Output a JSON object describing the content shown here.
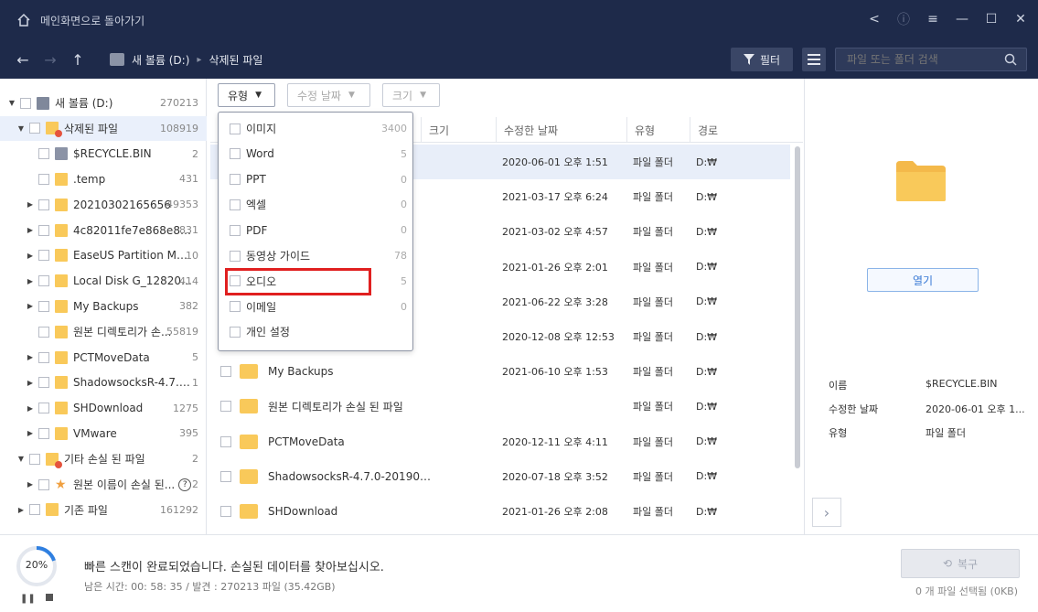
{
  "app": {
    "title": "메인화면으로 돌아가기"
  },
  "nav": {
    "breadcrumb": [
      "새 볼륨 (D:)",
      "삭제된 파일"
    ],
    "filter_label": "필터",
    "search_placeholder": "파일 또는 폴더 검색"
  },
  "tree": [
    {
      "label": "새 볼륨 (D:)",
      "count": "270213",
      "indent": 0,
      "expanded": true,
      "type": "drive"
    },
    {
      "label": "삭제된 파일",
      "count": "108919",
      "indent": 1,
      "expanded": true,
      "type": "deleted",
      "selected": true
    },
    {
      "label": "$RECYCLE.BIN",
      "count": "2",
      "indent": 2,
      "expandable": false,
      "type": "recycle"
    },
    {
      "label": ".temp",
      "count": "431",
      "indent": 2,
      "expandable": false,
      "type": "folder"
    },
    {
      "label": "20210302165656",
      "count": "49353",
      "indent": 2,
      "expandable": true,
      "type": "folder"
    },
    {
      "label": "4c82011fe7e868e8df9...",
      "count": "831",
      "indent": 2,
      "expandable": true,
      "type": "folder"
    },
    {
      "label": "EaseUS Partition Maste...",
      "count": "10",
      "indent": 2,
      "expandable": true,
      "type": "folder"
    },
    {
      "label": "Local Disk G_1282020...",
      "count": "414",
      "indent": 2,
      "expandable": true,
      "type": "folder"
    },
    {
      "label": "My Backups",
      "count": "382",
      "indent": 2,
      "expandable": true,
      "type": "folder"
    },
    {
      "label": "원본 디렉토리가 손...",
      "count": "55819",
      "indent": 2,
      "expandable": false,
      "type": "folder"
    },
    {
      "label": "PCTMoveData",
      "count": "5",
      "indent": 2,
      "expandable": true,
      "type": "folder"
    },
    {
      "label": "ShadowsocksR-4.7.0-201...",
      "count": "1",
      "indent": 2,
      "expandable": true,
      "type": "folder"
    },
    {
      "label": "SHDownload",
      "count": "1275",
      "indent": 2,
      "expandable": true,
      "type": "folder"
    },
    {
      "label": "VMware",
      "count": "395",
      "indent": 2,
      "expandable": true,
      "type": "folder"
    },
    {
      "label": "기타 손실 된 파일",
      "count": "2",
      "indent": 1,
      "expanded": true,
      "type": "lost"
    },
    {
      "label": "원본 이름이 손실 된...",
      "count": "2",
      "indent": 2,
      "expandable": true,
      "type": "star",
      "help": "?"
    },
    {
      "label": "기존 파일",
      "count": "161292",
      "indent": 1,
      "expandable": true,
      "type": "folder"
    }
  ],
  "filter_tabs": [
    {
      "label": "유형",
      "active": true
    },
    {
      "label": "수정 날짜",
      "active": false
    },
    {
      "label": "크기",
      "active": false
    }
  ],
  "dropdown": [
    {
      "label": "이미지",
      "count": "3400"
    },
    {
      "label": "Word",
      "count": "5"
    },
    {
      "label": "PPT",
      "count": "0"
    },
    {
      "label": "엑셀",
      "count": "0"
    },
    {
      "label": "PDF",
      "count": "0"
    },
    {
      "label": "동영상 가이드",
      "count": "78"
    },
    {
      "label": "오디오",
      "count": "5"
    },
    {
      "label": "이메일",
      "count": "0"
    },
    {
      "label": "개인 설정",
      "count": ""
    }
  ],
  "table": {
    "headers": [
      "크기",
      "수정한 날짜",
      "유형",
      "경로"
    ],
    "rows": [
      {
        "name": "",
        "date": "2020-06-01 오후 1:51",
        "type": "파일 폴더",
        "path": "D:₩",
        "selected": true
      },
      {
        "name": "",
        "date": "2021-03-17 오후 6:24",
        "type": "파일 폴더",
        "path": "D:₩"
      },
      {
        "name": "",
        "date": "2021-03-02 오후 4:57",
        "type": "파일 폴더",
        "path": "D:₩"
      },
      {
        "name": "",
        "date": "2021-01-26 오후 2:01",
        "type": "파일 폴더",
        "path": "D:₩"
      },
      {
        "name": "",
        "date": "2021-06-22 오후 3:28",
        "type": "파일 폴더",
        "path": "D:₩"
      },
      {
        "name": "",
        "date": "2020-12-08 오후 12:53",
        "type": "파일 폴더",
        "path": "D:₩"
      },
      {
        "name": "My Backups",
        "date": "2021-06-10 오후 1:53",
        "type": "파일 폴더",
        "path": "D:₩"
      },
      {
        "name": "원본 디렉토리가 손실 된 파일",
        "date": "",
        "type": "파일 폴더",
        "path": "D:₩"
      },
      {
        "name": "PCTMoveData",
        "date": "2020-12-11 오후 4:11",
        "type": "파일 폴더",
        "path": "D:₩"
      },
      {
        "name": "ShadowsocksR-4.7.0-2019092...",
        "date": "2020-07-18 오후 3:52",
        "type": "파일 폴더",
        "path": "D:₩"
      },
      {
        "name": "SHDownload",
        "date": "2021-01-26 오후 2:08",
        "type": "파일 폴더",
        "path": "D:₩"
      }
    ]
  },
  "preview": {
    "open_label": "열기",
    "props": [
      {
        "key": "이름",
        "value": "$RECYCLE.BIN"
      },
      {
        "key": "수정한 날짜",
        "value": "2020-06-01 오후 1..."
      },
      {
        "key": "유형",
        "value": "파일 폴더"
      }
    ]
  },
  "footer": {
    "progress": "20%",
    "progress_value": 0.2,
    "status": "빠른 스캔이 완료되었습니다. 손실된  데이터를 찾아보십시오.",
    "sub_status": "남은 시간: 00: 58: 35 / 발견 : 270213 파일 (35.42GB)",
    "recover_label": "복구",
    "selection": "0 개 파일 선택됨 (0KB)"
  },
  "colors": {
    "titlebar": "#1e2a4a",
    "folder": "#f9c95a",
    "highlight": "#e02020",
    "accent": "#3577d4"
  }
}
